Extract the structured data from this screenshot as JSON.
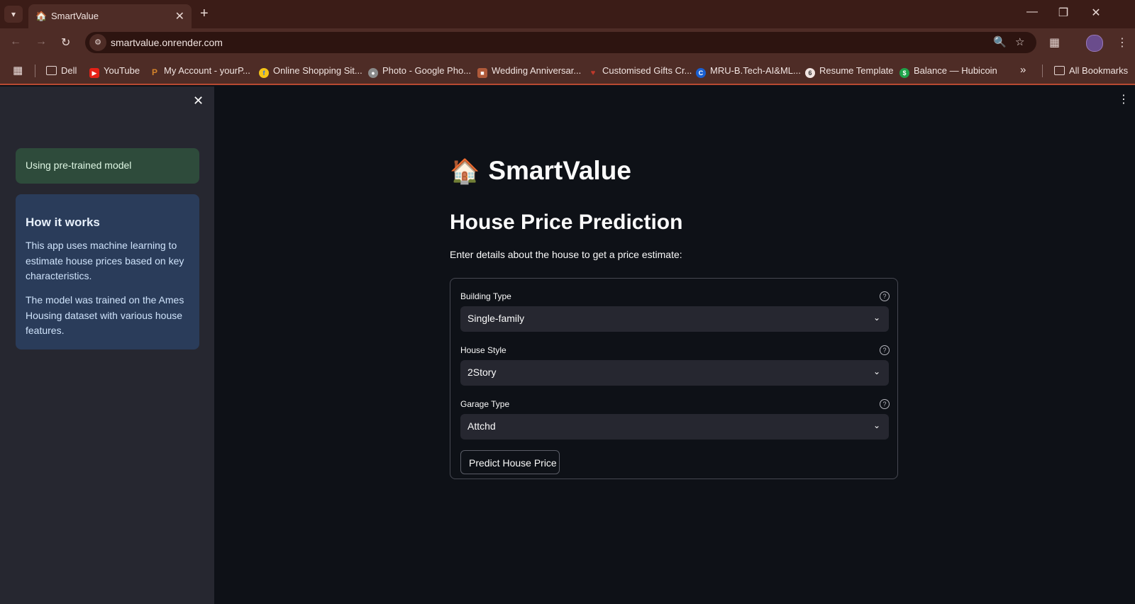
{
  "browser": {
    "tab": {
      "title": "SmartValue",
      "favicon": "house-icon"
    },
    "url": "smartvalue.onrender.com",
    "bookmarks": [
      {
        "label": "Dell",
        "icon": "folder-icon"
      },
      {
        "label": "YouTube",
        "icon": "youtube-icon",
        "color": "#e62117"
      },
      {
        "label": "My Account - yourP...",
        "icon": "yourp-icon",
        "color": "#d4832b"
      },
      {
        "label": "Online Shopping Sit...",
        "icon": "flipkart-icon",
        "color": "#2874f0"
      },
      {
        "label": "Photo - Google Pho...",
        "icon": "globe-icon",
        "color": "#8a8a8a"
      },
      {
        "label": "Wedding Anniversar...",
        "icon": "gift-icon",
        "color": "#b05a3a"
      },
      {
        "label": "Customised Gifts Cr...",
        "icon": "heart-icon",
        "color": "#c0392b"
      },
      {
        "label": "MRU-B.Tech-AI&ML...",
        "icon": "c-icon",
        "color": "#1a5fd1"
      },
      {
        "label": "Resume Template",
        "icon": "spiral-icon",
        "color": "#444444"
      },
      {
        "label": "Balance — Hubicoin",
        "icon": "hubicoin-icon",
        "color": "#1fa34a"
      }
    ],
    "all_bookmarks_label": "All Bookmarks"
  },
  "sidebar": {
    "status": "Using pre-trained model",
    "info": {
      "title": "How it works",
      "p1": "This app uses machine learning to estimate house prices based on key characteristics.",
      "p2": "The model was trained on the Ames Housing dataset with various house features."
    }
  },
  "main": {
    "title_emoji": "🏠",
    "title": "SmartValue",
    "subheader": "House Price Prediction",
    "intro": "Enter details about the house to get a price estimate:",
    "fields": [
      {
        "label": "Building Type",
        "value": "Single-family"
      },
      {
        "label": "House Style",
        "value": "2Story"
      },
      {
        "label": "Garage Type",
        "value": "Attchd"
      }
    ],
    "submit_label": "Predict House Price"
  },
  "colors": {
    "app_bg": "#0e1117",
    "sidebar_bg": "#262730",
    "success_bg": "#2e4b3b",
    "info_bg": "#2a3c5a",
    "chrome_bg": "#4e2c26"
  }
}
